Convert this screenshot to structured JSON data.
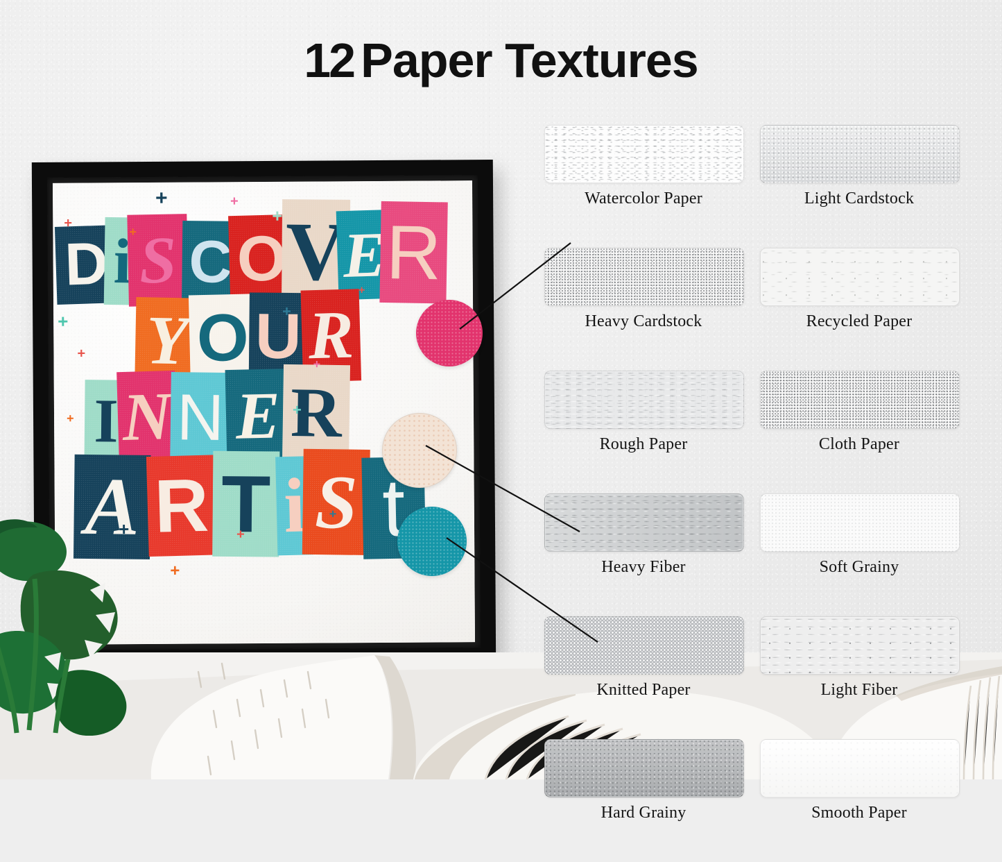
{
  "header": {
    "title_number": "12",
    "title_text": "Paper Textures"
  },
  "poster": {
    "artwork_text": "DISCOVER YOUR INNER ARTIST",
    "lines": [
      {
        "word": "DISCOVER",
        "letters": [
          "D",
          "i",
          "S",
          "C",
          "O",
          "V",
          "E",
          "R"
        ]
      },
      {
        "word": "YOUR",
        "letters": [
          "Y",
          "O",
          "U",
          "R"
        ]
      },
      {
        "word": "INNER",
        "letters": [
          "I",
          "N",
          "N",
          "E",
          "R"
        ]
      },
      {
        "word": "ARTIST",
        "letters": [
          "A",
          "R",
          "T",
          "i",
          "S",
          "t"
        ]
      }
    ]
  },
  "colors": {
    "wall": "#ececec",
    "frame": "#0c0c0c",
    "navy": "#16425b",
    "deep_navy": "#123a52",
    "magenta": "#e2336d",
    "pink": "#ef6ea3",
    "hot_pink": "#e84a7f",
    "red": "#d9221f",
    "bright_red": "#e8392c",
    "orange": "#f06c21",
    "orange_red": "#ea4b1e",
    "teal": "#1596a8",
    "dark_teal": "#15697d",
    "mint": "#9fdcc8",
    "light_teal": "#5ec8d4",
    "cream": "#e9d8c8",
    "blush": "#f6cfc0",
    "off_white": "#f7f3ec",
    "leaf_green": "#1f6b33"
  },
  "swatches": [
    {
      "label": "Watercolor Paper",
      "texture": "t-watercolor",
      "callout": false
    },
    {
      "label": "Light Cardstock",
      "texture": "t-lightcard",
      "callout": false
    },
    {
      "label": "Heavy Cardstock",
      "texture": "t-heavycard",
      "callout": true
    },
    {
      "label": "Recycled Paper",
      "texture": "t-recycled",
      "callout": false
    },
    {
      "label": "Rough Paper",
      "texture": "t-rough",
      "callout": false
    },
    {
      "label": "Cloth Paper",
      "texture": "t-cloth",
      "callout": false
    },
    {
      "label": "Heavy Fiber",
      "texture": "t-heavyfiber",
      "callout": false
    },
    {
      "label": "Soft Grainy",
      "texture": "t-softgrainy",
      "callout": false
    },
    {
      "label": "Knitted Paper",
      "texture": "t-knitted",
      "callout": true
    },
    {
      "label": "Light Fiber",
      "texture": "t-lightfiber",
      "callout": false
    },
    {
      "label": "Hard Grainy",
      "texture": "t-hardgrainy",
      "callout": true
    },
    {
      "label": "Smooth Paper",
      "texture": "t-smooth",
      "callout": false
    }
  ],
  "callouts": [
    {
      "name": "magenta-circle",
      "color": "#e2336d",
      "target": "Heavy Cardstock"
    },
    {
      "name": "cream-circle",
      "color": "#f3e3d5",
      "target": "Knitted Paper"
    },
    {
      "name": "teal-circle",
      "color": "#1596a8",
      "target": "Hard Grainy"
    }
  ],
  "scene": {
    "plant": "monstera-plant",
    "furniture": "white-sofa-with-pillows"
  }
}
